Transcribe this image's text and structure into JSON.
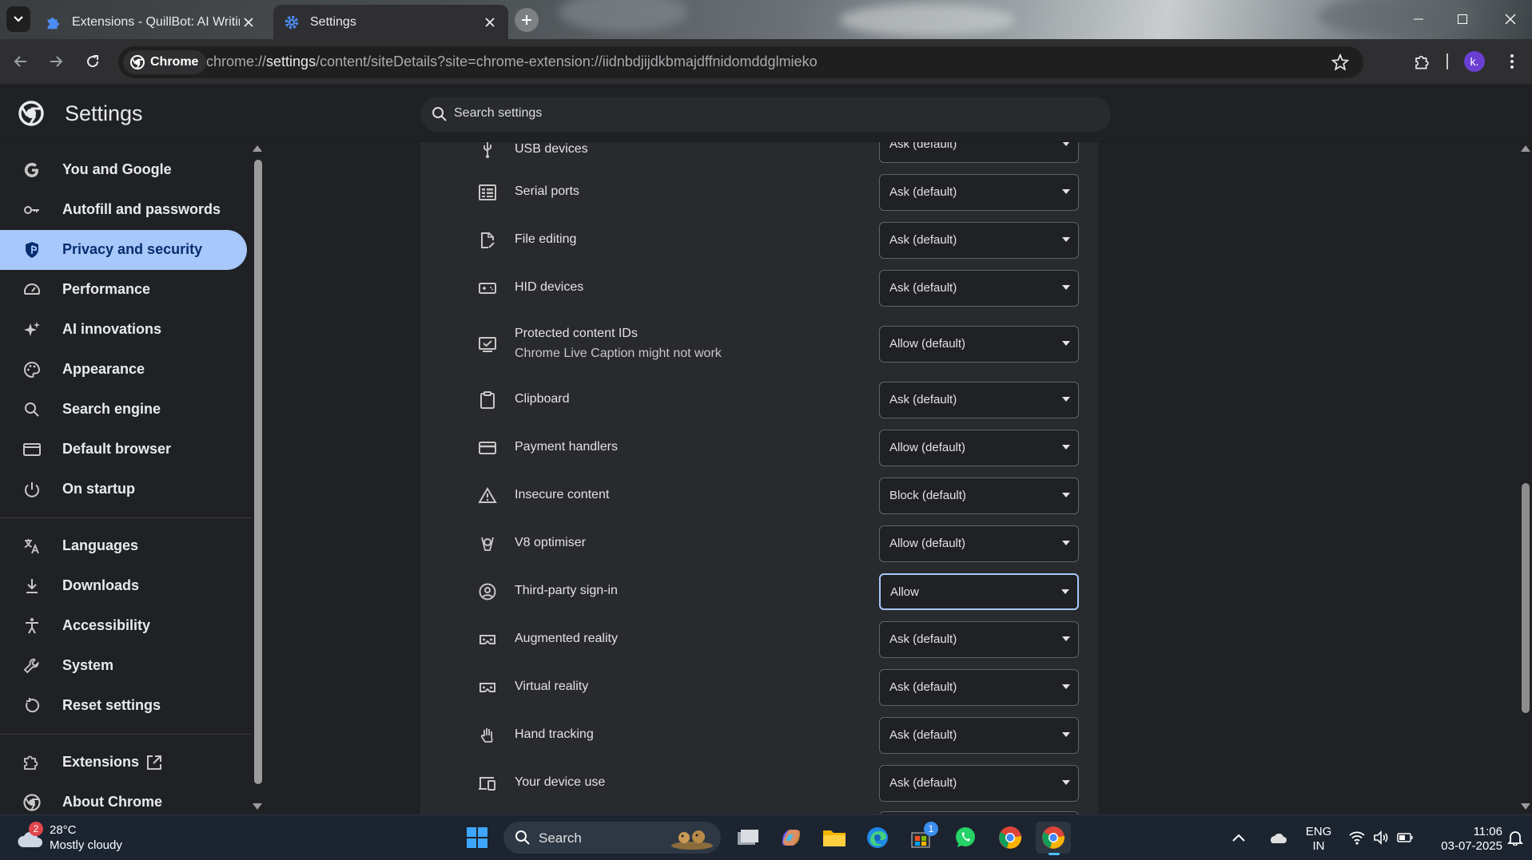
{
  "browser": {
    "tabs": [
      {
        "title": "Extensions - QuillBot: AI Writing",
        "active": false
      },
      {
        "title": "Settings",
        "active": true
      }
    ],
    "chip_label": "Chrome",
    "url_host": "chrome://",
    "url_strong": "settings",
    "url_rest": "/content/siteDetails?site=chrome-extension://iidnbdjijdkbmajdffnidomddglmieko",
    "profile_initial": "k."
  },
  "settings": {
    "title": "Settings",
    "search_placeholder": "Search settings"
  },
  "sidebar": {
    "items": [
      {
        "label": "You and Google",
        "icon": "google-g-icon"
      },
      {
        "label": "Autofill and passwords",
        "icon": "key-icon"
      },
      {
        "label": "Privacy and security",
        "icon": "shield-icon",
        "active": true
      },
      {
        "label": "Performance",
        "icon": "speedometer-icon"
      },
      {
        "label": "AI innovations",
        "icon": "sparkle-icon"
      },
      {
        "label": "Appearance",
        "icon": "palette-icon"
      },
      {
        "label": "Search engine",
        "icon": "search-icon"
      },
      {
        "label": "Default browser",
        "icon": "browser-window-icon"
      },
      {
        "label": "On startup",
        "icon": "power-icon"
      },
      {
        "label": "Languages",
        "icon": "translate-icon"
      },
      {
        "label": "Downloads",
        "icon": "download-icon"
      },
      {
        "label": "Accessibility",
        "icon": "accessibility-icon"
      },
      {
        "label": "System",
        "icon": "wrench-icon"
      },
      {
        "label": "Reset settings",
        "icon": "reset-icon"
      },
      {
        "label": "Extensions",
        "icon": "puzzle-icon"
      },
      {
        "label": "About Chrome",
        "icon": "chrome-logo-icon"
      }
    ]
  },
  "permissions": [
    {
      "label": "USB devices",
      "value": "Ask (default)",
      "icon": "usb-icon"
    },
    {
      "label": "Serial ports",
      "value": "Ask (default)",
      "icon": "serial-port-icon"
    },
    {
      "label": "File editing",
      "value": "Ask (default)",
      "icon": "file-edit-icon"
    },
    {
      "label": "HID devices",
      "value": "Ask (default)",
      "icon": "hid-device-icon"
    },
    {
      "label": "Protected content IDs",
      "sublabel": "Chrome Live Caption might not work",
      "value": "Allow (default)",
      "icon": "protected-content-icon"
    },
    {
      "label": "Clipboard",
      "value": "Ask (default)",
      "icon": "clipboard-icon"
    },
    {
      "label": "Payment handlers",
      "value": "Allow (default)",
      "icon": "credit-card-icon"
    },
    {
      "label": "Insecure content",
      "value": "Block (default)",
      "icon": "warning-icon"
    },
    {
      "label": "V8 optimiser",
      "value": "Allow (default)",
      "icon": "v8-icon"
    },
    {
      "label": "Third-party sign-in",
      "value": "Allow",
      "icon": "account-circle-icon"
    },
    {
      "label": "Augmented reality",
      "value": "Ask (default)",
      "icon": "vr-headset-icon"
    },
    {
      "label": "Virtual reality",
      "value": "Ask (default)",
      "icon": "vr-headset-icon"
    },
    {
      "label": "Hand tracking",
      "value": "Ask (default)",
      "icon": "hand-icon"
    },
    {
      "label": "Your device use",
      "value": "Ask (default)",
      "icon": "devices-icon"
    }
  ],
  "taskbar": {
    "weather_temp": "28°C",
    "weather_desc": "Mostly cloudy",
    "weather_badge": "2",
    "search_label": "Search",
    "lang_line1": "ENG",
    "lang_line2": "IN",
    "time": "11:06",
    "date": "03-07-2025",
    "store_badge": "1"
  },
  "colors": {
    "accent": "#a8c7fa",
    "active_nav_text": "#062e6f",
    "background": "#202124",
    "card": "#292a2d"
  }
}
